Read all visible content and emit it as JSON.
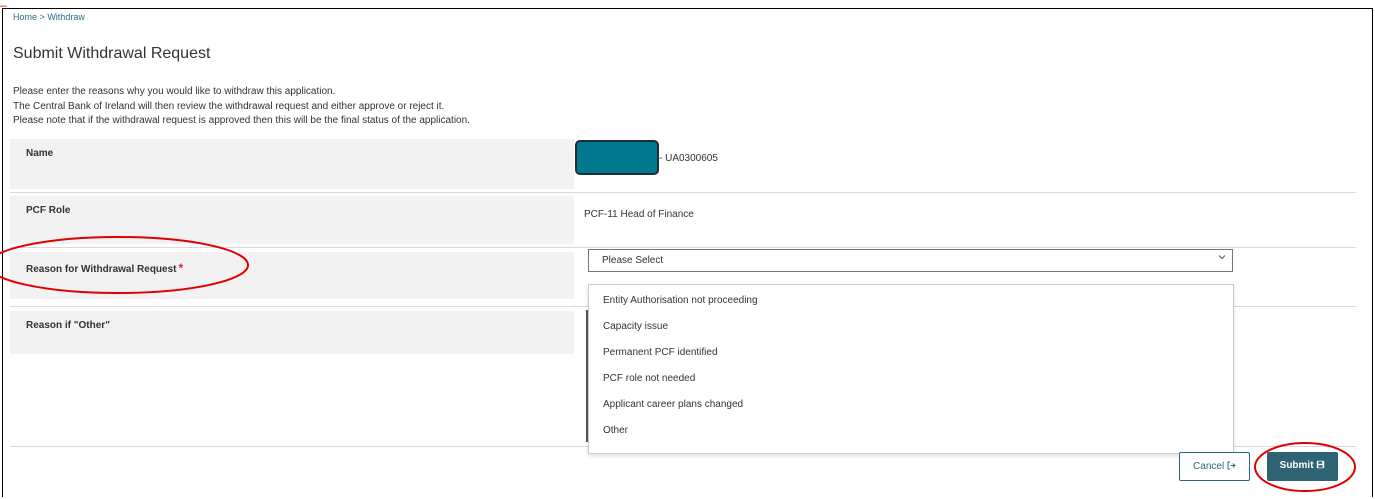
{
  "breadcrumb": {
    "home": "Home",
    "separator": ">",
    "current": "Withdraw"
  },
  "page_title": "Submit Withdrawal Request",
  "intro": [
    "Please enter the reasons why you would like to withdraw this application.",
    "The Central Bank of Ireland will then review the withdrawal request and either approve or reject it.",
    "Please note that if the withdrawal request is approved then this will be the final status of the application."
  ],
  "fields": {
    "name": {
      "label": "Name",
      "value_suffix": "- UA0300605"
    },
    "pcf_role": {
      "label": "PCF Role",
      "value": "PCF-11 Head of Finance"
    },
    "reason": {
      "label": "Reason for Withdrawal Request",
      "required_mark": "*",
      "selected": "Please Select"
    },
    "reason_other": {
      "label": "Reason if \"Other\""
    }
  },
  "dropdown_options": [
    "Entity Authorisation not proceeding",
    "Capacity issue",
    "Permanent PCF identified",
    "PCF role not needed",
    "Applicant career plans changed",
    "Other"
  ],
  "buttons": {
    "cancel": "Cancel",
    "submit": "Submit"
  },
  "colors": {
    "primary": "#2d6373",
    "link": "#2a6c83",
    "required": "#d0283b",
    "annotation": "#e00000",
    "redaction": "#00788e"
  }
}
